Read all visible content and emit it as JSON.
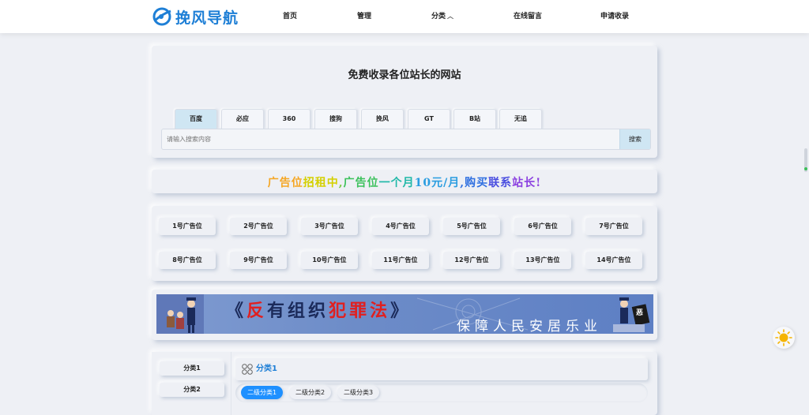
{
  "header": {
    "logo_text": "挽风导航",
    "nav": [
      {
        "label": "首页"
      },
      {
        "label": "管理"
      },
      {
        "label": "分类"
      },
      {
        "label": "在线留言"
      },
      {
        "label": "申请收录"
      }
    ]
  },
  "search": {
    "title": "免费收录各位站长的网站",
    "tabs": [
      "百度",
      "必应",
      "360",
      "搜狗",
      "挽风",
      "GT",
      "B站",
      "无追"
    ],
    "active_tab": "百度",
    "placeholder": "请输入搜索内容",
    "button": "搜索"
  },
  "ad_notice": {
    "segments": [
      {
        "text": "广告位",
        "color": "#f5a623"
      },
      {
        "text": "招租中",
        "color": "#d4d000"
      },
      {
        "text": ",",
        "color": "#7ac943"
      },
      {
        "text": "广告位",
        "color": "#3cc15c"
      },
      {
        "text": "一个月",
        "color": "#20b8a8"
      },
      {
        "text": "10元/月",
        "color": "#2a9de0"
      },
      {
        "text": ",购买",
        "color": "#2f6fe0"
      },
      {
        "text": "联系",
        "color": "#4a4ee0"
      },
      {
        "text": "站长!",
        "color": "#8a3fe0"
      }
    ]
  },
  "ad_slots": [
    "1号广告位",
    "2号广告位",
    "3号广告位",
    "4号广告位",
    "5号广告位",
    "6号广告位",
    "7号广告位",
    "8号广告位",
    "9号广告位",
    "10号广告位",
    "11号广告位",
    "12号广告位",
    "13号广告位",
    "14号广告位"
  ],
  "banner": {
    "title_open": "《",
    "title_chars": [
      {
        "text": "反",
        "color": "#e02020"
      },
      {
        "text": "有",
        "color": "#1b2a5a"
      },
      {
        "text": "组",
        "color": "#1b2a5a"
      },
      {
        "text": "织",
        "color": "#1b2a5a"
      },
      {
        "text": "犯",
        "color": "#e02020"
      },
      {
        "text": "罪",
        "color": "#e02020"
      },
      {
        "text": "法",
        "color": "#e02020"
      }
    ],
    "title_close": "》",
    "subtitle": "保障人民安居乐业",
    "badge_char": "恶"
  },
  "categories": {
    "sidebar": [
      "分类1",
      "分类2"
    ],
    "current": "分类1",
    "icon": "grid-icon",
    "subtabs": [
      "二级分类1",
      "二级分类2",
      "二级分类3"
    ],
    "active_subtab": "二级分类1"
  },
  "colors": {
    "accent": "#1e7fd6",
    "active_tab": "#cfe6f3",
    "active_subtab": "#1e90ff"
  }
}
